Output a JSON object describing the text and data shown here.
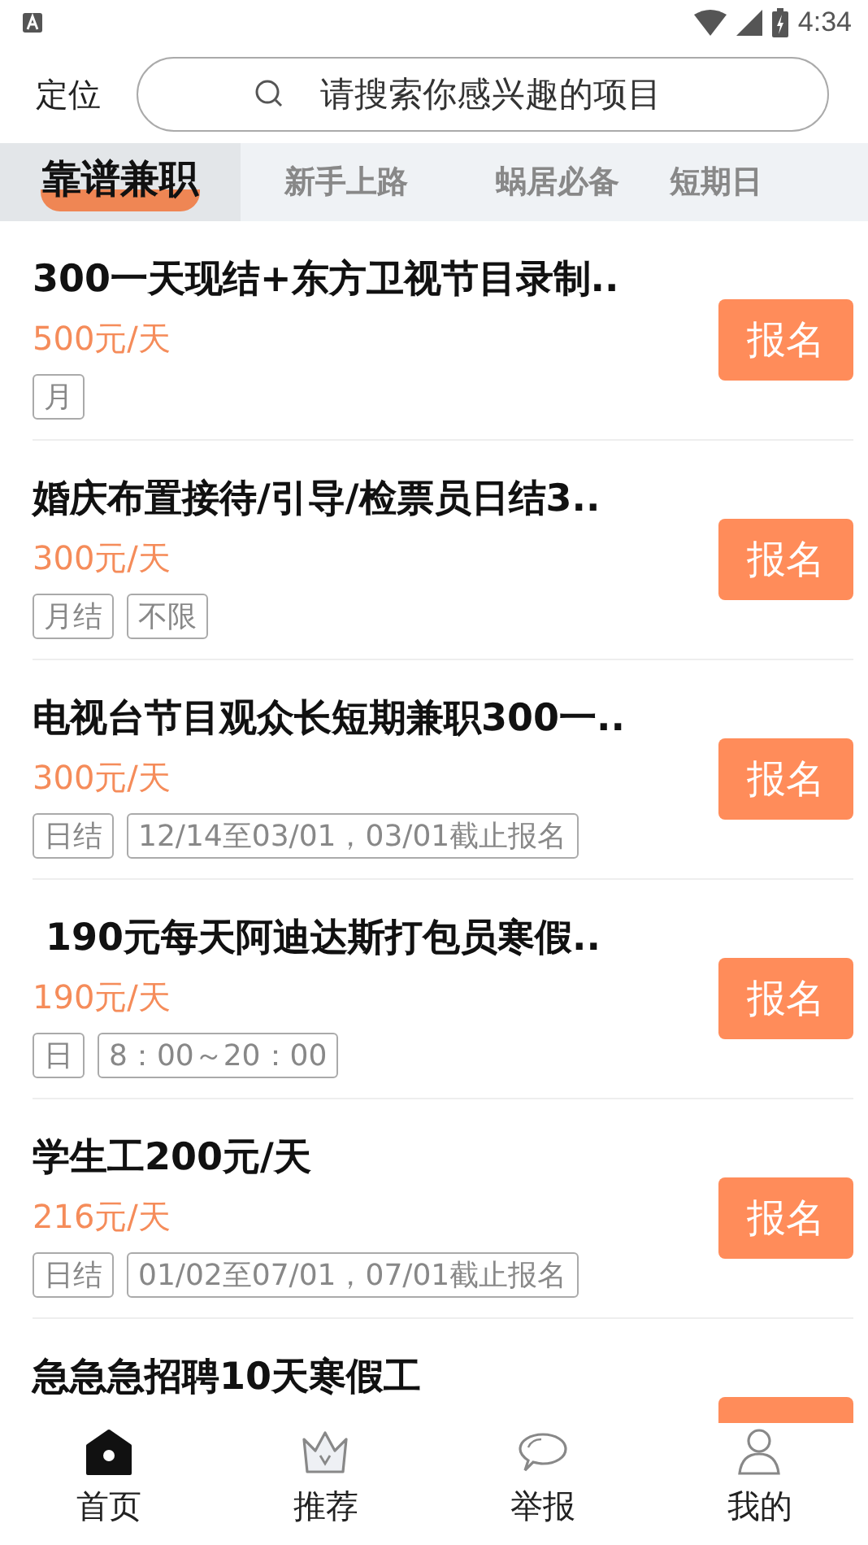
{
  "status_bar": {
    "time": "4:34"
  },
  "header": {
    "location": "定位",
    "search": {
      "placeholder": "请搜索你感兴趣的项目"
    }
  },
  "tabs": [
    {
      "label": "靠谱兼职",
      "selected": true
    },
    {
      "label": "新手上路",
      "selected": false
    },
    {
      "label": "蜗居必备",
      "selected": false
    },
    {
      "label": "短期日",
      "selected": false
    }
  ],
  "jobs": [
    {
      "title": "300一天现结+东方卫视节目录制..",
      "pay": "500元/天",
      "tags": [
        "月"
      ],
      "button": "报名"
    },
    {
      "title": "婚庆布置接待/引导/检票员日结3..",
      "pay": "300元/天",
      "tags": [
        "月结",
        "不限"
      ],
      "button": "报名"
    },
    {
      "title": "电视台节目观众长短期兼职300一..",
      "pay": "300元/天",
      "tags": [
        "日结",
        "12/14至03/01，03/01截止报名"
      ],
      "button": "报名"
    },
    {
      "title": " 190元每天阿迪达斯打包员寒假..",
      "pay": "190元/天",
      "tags": [
        "日",
        "8：00～20：00"
      ],
      "button": "报名"
    },
    {
      "title": "学生工200元/天",
      "pay": "216元/天",
      "tags": [
        "日结",
        "01/02至07/01，07/01截止报名"
      ],
      "button": "报名"
    },
    {
      "title": "急急急招聘10天寒假工"
    }
  ],
  "nav": [
    {
      "label": "首页",
      "kind": "home",
      "selected": true
    },
    {
      "label": "推荐",
      "kind": "crown",
      "selected": false
    },
    {
      "label": "举报",
      "kind": "chat",
      "selected": false
    },
    {
      "label": "我的",
      "kind": "person",
      "selected": false
    }
  ]
}
